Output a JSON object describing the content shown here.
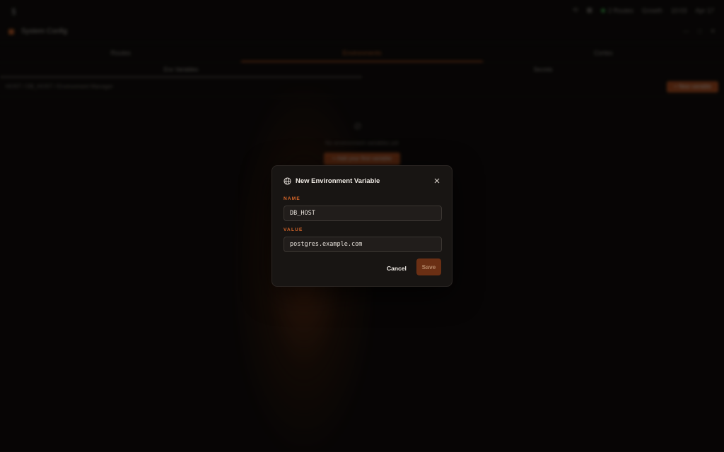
{
  "background": {
    "titlebar": {
      "status_1": "2 Routes",
      "status_2": "Growth",
      "status_3": "10:03",
      "date": "Apr 17"
    },
    "app_title": "System Config",
    "tabs": [
      {
        "label": "Routes"
      },
      {
        "label": "Environments"
      },
      {
        "label": "Cortex"
      }
    ],
    "subtabs": [
      {
        "label": "Env Variables"
      },
      {
        "label": "Secrets"
      }
    ],
    "breadcrumb": "HOST / DB_HOST / Environment Manager",
    "new_button": "+ New variable",
    "empty_text": "No environment variables yet",
    "empty_button": "+ Add your first variable"
  },
  "modal": {
    "title": "New Environment Variable",
    "name_label": "NAME",
    "name_value": "DB_HOST",
    "value_label": "VALUE",
    "value_value": "postgres.example.com",
    "cancel_label": "Cancel",
    "save_label": "Save"
  },
  "colors": {
    "accent": "#d9672a",
    "save_disabled_bg": "#6a2f14",
    "modal_bg": "#181513"
  },
  "icons": {
    "header": "globe-icon",
    "close": "close-icon"
  }
}
